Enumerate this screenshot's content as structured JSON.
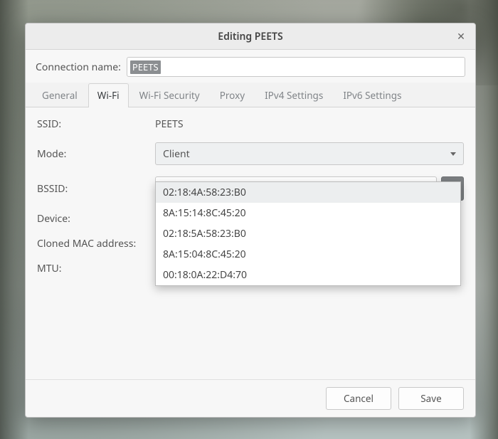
{
  "window": {
    "title": "Editing PEETS",
    "close_label": "✕"
  },
  "connection": {
    "name_label": "Connection name:",
    "name_value": "PEETS"
  },
  "tabs": [
    {
      "id": "general",
      "label": "General"
    },
    {
      "id": "wifi",
      "label": "Wi-Fi",
      "active": true
    },
    {
      "id": "wifisec",
      "label": "Wi-Fi Security"
    },
    {
      "id": "proxy",
      "label": "Proxy"
    },
    {
      "id": "ipv4",
      "label": "IPv4 Settings"
    },
    {
      "id": "ipv6",
      "label": "IPv6 Settings"
    }
  ],
  "form": {
    "ssid_label": "SSID:",
    "ssid_value": "PEETS",
    "mode_label": "Mode:",
    "mode_value": "Client",
    "bssid_label": "BSSID:",
    "bssid_value": "",
    "device_label": "Device:",
    "cloned_mac_label": "Cloned MAC address:",
    "mtu_label": "MTU:"
  },
  "bssid_dropdown": {
    "open": true,
    "options": [
      "02:18:4A:58:23:B0",
      "8A:15:14:8C:45:20",
      "02:18:5A:58:23:B0",
      "8A:15:04:8C:45:20",
      "00:18:0A:22:D4:70"
    ],
    "highlighted_index": 0
  },
  "buttons": {
    "cancel": "Cancel",
    "save": "Save"
  },
  "colors": {
    "window_bg": "#f7f7f7",
    "border": "#c8c8c8",
    "selection_bg": "#8b8e91",
    "dark_button": "#7c7f82"
  }
}
